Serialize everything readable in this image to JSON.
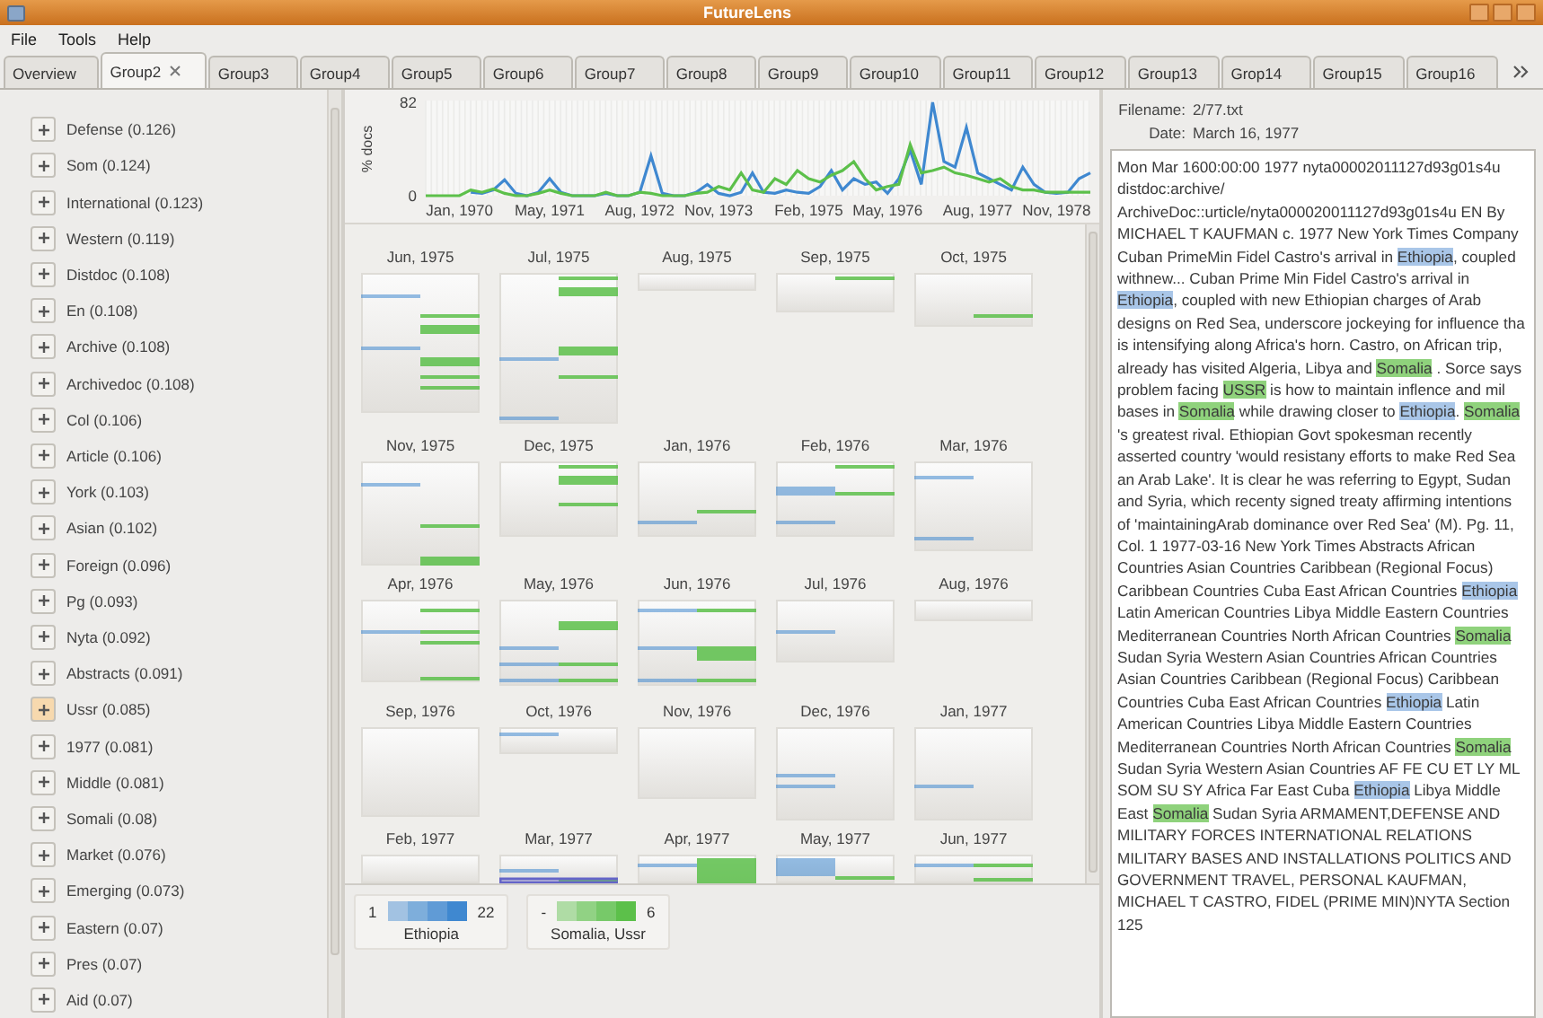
{
  "window": {
    "title": "FutureLens"
  },
  "menu": [
    "File",
    "Tools",
    "Help"
  ],
  "tabs": [
    {
      "label": "Overview",
      "selected": false
    },
    {
      "label": "Group2",
      "selected": true
    },
    {
      "label": "Group3",
      "selected": false
    },
    {
      "label": "Group4",
      "selected": false
    },
    {
      "label": "Group5",
      "selected": false
    },
    {
      "label": "Group6",
      "selected": false
    },
    {
      "label": "Group7",
      "selected": false
    },
    {
      "label": "Group8",
      "selected": false
    },
    {
      "label": "Group9",
      "selected": false
    },
    {
      "label": "Group10",
      "selected": false
    },
    {
      "label": "Group11",
      "selected": false
    },
    {
      "label": "Group12",
      "selected": false
    },
    {
      "label": "Group13",
      "selected": false
    },
    {
      "label": "Grop14",
      "selected": false
    },
    {
      "label": "Group15",
      "selected": false
    },
    {
      "label": "Group16",
      "selected": false
    }
  ],
  "sidebar": {
    "terms": [
      {
        "label": "Defense (0.126)",
        "selected": false
      },
      {
        "label": "Som (0.124)",
        "selected": false
      },
      {
        "label": "International (0.123)",
        "selected": false
      },
      {
        "label": "Western (0.119)",
        "selected": false
      },
      {
        "label": "Distdoc (0.108)",
        "selected": false
      },
      {
        "label": "En (0.108)",
        "selected": false
      },
      {
        "label": "Archive (0.108)",
        "selected": false
      },
      {
        "label": "Archivedoc (0.108)",
        "selected": false
      },
      {
        "label": "Col (0.106)",
        "selected": false
      },
      {
        "label": "Article (0.106)",
        "selected": false
      },
      {
        "label": "York (0.103)",
        "selected": false
      },
      {
        "label": "Asian (0.102)",
        "selected": false
      },
      {
        "label": "Foreign (0.096)",
        "selected": false
      },
      {
        "label": "Pg (0.093)",
        "selected": false
      },
      {
        "label": "Nyta (0.092)",
        "selected": false
      },
      {
        "label": "Abstracts (0.091)",
        "selected": false
      },
      {
        "label": "Ussr (0.085)",
        "selected": true
      },
      {
        "label": "1977 (0.081)",
        "selected": false
      },
      {
        "label": "Middle (0.081)",
        "selected": false
      },
      {
        "label": "Somali (0.08)",
        "selected": false
      },
      {
        "label": "Market (0.076)",
        "selected": false
      },
      {
        "label": "Emerging (0.073)",
        "selected": false
      },
      {
        "label": "Eastern (0.07)",
        "selected": false
      },
      {
        "label": "Pres (0.07)",
        "selected": false
      },
      {
        "label": "Aid (0.07)",
        "selected": false
      }
    ]
  },
  "timeline": {
    "chart_data": {
      "type": "line",
      "grid": true,
      "ylabel": "% docs",
      "ylim": [
        0,
        82
      ],
      "yticks": [
        0,
        82
      ],
      "categories": [
        null,
        null,
        null,
        "Jan, 1970",
        null,
        null,
        null,
        null,
        null,
        null,
        null,
        "May, 1971",
        null,
        null,
        null,
        null,
        null,
        null,
        null,
        "Aug, 1972",
        null,
        null,
        null,
        null,
        null,
        null,
        "Nov, 1973",
        null,
        null,
        null,
        null,
        null,
        null,
        null,
        "Feb, 1975",
        null,
        null,
        null,
        null,
        null,
        null,
        "May, 1976",
        null,
        null,
        null,
        null,
        null,
        null,
        null,
        "Aug, 1977",
        null,
        null,
        null,
        null,
        null,
        null,
        "Nov, 1978",
        null,
        null,
        null
      ],
      "series": [
        {
          "color": "#3f88d0",
          "values": [
            null,
            null,
            null,
            null,
            3,
            2,
            5,
            14,
            2,
            0,
            3,
            15,
            3,
            0,
            0,
            0,
            2,
            0,
            0,
            3,
            35,
            2,
            0,
            0,
            3,
            10,
            2,
            0,
            3,
            20,
            3,
            2,
            5,
            3,
            2,
            8,
            22,
            5,
            15,
            10,
            12,
            2,
            15,
            40,
            10,
            82,
            30,
            25,
            60,
            20,
            15,
            10,
            5,
            25,
            10,
            3,
            2,
            3,
            15,
            20
          ]
        },
        {
          "color": "#5cc04a",
          "values": [
            0,
            0,
            0,
            0,
            5,
            3,
            6,
            2,
            0,
            0,
            2,
            5,
            2,
            0,
            0,
            0,
            3,
            0,
            0,
            3,
            2,
            0,
            0,
            0,
            2,
            3,
            8,
            5,
            20,
            5,
            3,
            15,
            10,
            22,
            15,
            12,
            18,
            22,
            30,
            15,
            5,
            8,
            10,
            45,
            20,
            22,
            25,
            20,
            18,
            15,
            12,
            15,
            8,
            5,
            5,
            3,
            3,
            3,
            3,
            3
          ]
        }
      ]
    }
  },
  "calendar": {
    "months": [
      {
        "label": "Jun, 1975"
      },
      {
        "label": "Jul, 1975"
      },
      {
        "label": "Aug, 1975"
      },
      {
        "label": "Sep, 1975"
      },
      {
        "label": "Oct, 1975"
      },
      {
        "label": "Nov, 1975"
      },
      {
        "label": "Dec, 1975"
      },
      {
        "label": "Jan, 1976"
      },
      {
        "label": "Feb, 1976"
      },
      {
        "label": "Mar, 1976"
      },
      {
        "label": "Apr, 1976"
      },
      {
        "label": "May, 1976"
      },
      {
        "label": "Jun, 1976"
      },
      {
        "label": "Jul, 1976"
      },
      {
        "label": "Aug, 1976"
      },
      {
        "label": "Sep, 1976"
      },
      {
        "label": "Oct, 1976"
      },
      {
        "label": "Nov, 1976"
      },
      {
        "label": "Dec, 1976"
      },
      {
        "label": "Jan, 1977"
      },
      {
        "label": "Feb, 1977"
      },
      {
        "label": "Mar, 1977"
      },
      {
        "label": "Apr, 1977"
      },
      {
        "label": "May, 1977"
      },
      {
        "label": "Jun, 1977"
      }
    ],
    "legend": [
      {
        "min": "1",
        "max": "22",
        "label": "Ethiopia",
        "color": "#3f88d0"
      },
      {
        "min": "-",
        "max": "6",
        "label": "Somalia, Ussr",
        "color": "#5cc04a"
      }
    ]
  },
  "document": {
    "filename_label": "Filename:",
    "filename": "2/77.txt",
    "date_label": "Date:",
    "date": "March 16, 1977",
    "segments": [
      {
        "text": "Mon Mar 1600:00:00 1977 nyta00002011127d93g01s4u distdoc:archive/ ArchiveDoc::urticle/nyta000020011127d93g01s4u EN By MICHAEL T KAUFMAN c. 1977 New York Times Company Cuban PrimeMin Fidel Castro's arrival in "
      },
      {
        "text": "Ethiopia",
        "color": "#a9c6e8"
      },
      {
        "text": ", coupled withnew... Cuban Prime Min Fidel Castro's arrival in "
      },
      {
        "text": "Ethiopia",
        "color": "#a9c6e8"
      },
      {
        "text": ", coupled with new Ethiopian charges of Arab designs on Red Sea, underscore jockeying for influence tha is intensifying along Africa's horn. Castro, on African trip, already has visited Algeria, Libya and "
      },
      {
        "text": "Somalia",
        "color": "#8fd27c"
      },
      {
        "text": " . Sorce says problem facing "
      },
      {
        "text": "USSR",
        "color": "#8fd27c"
      },
      {
        "text": " is how to maintain inflence and mil bases in "
      },
      {
        "text": "Somalia",
        "color": "#8fd27c"
      },
      {
        "text": " while drawing closer to "
      },
      {
        "text": "Ethiopia",
        "color": "#a9c6e8"
      },
      {
        "text": ". "
      },
      {
        "text": "Somalia",
        "color": "#8fd27c"
      },
      {
        "text": " 's greatest rival. Ethiopian Govt spokesman recently asserted country 'would resistany efforts to make Red Sea an Arab Lake'. It is clear he was referring to Egypt, Sudan and Syria, which recenty signed treaty affirming intentions of 'maintainingArab dominance over Red Sea' (M). Pg. 11, Col. 1 1977-03-16 New York Times Abstracts African Countries Asian Countries Caribbean (Regional Focus) Caribbean Countries Cuba East African Countries "
      },
      {
        "text": "Ethiopia",
        "color": "#a9c6e8"
      },
      {
        "text": " Latin American Countries Libya Middle Eastern Countries Mediterranean Countries North African Countries "
      },
      {
        "text": "Somalia",
        "color": "#8fd27c"
      },
      {
        "text": " Sudan Syria Western Asian Countries African Countries Asian Countries Caribbean (Regional Focus) Caribbean Countries Cuba East African Countries "
      },
      {
        "text": "Ethiopia",
        "color": "#a9c6e8"
      },
      {
        "text": " Latin American Countries Libya Middle Eastern Countries Mediterranean Countries North African Countries "
      },
      {
        "text": "Somalia",
        "color": "#8fd27c"
      },
      {
        "text": " Sudan Syria Western Asian Countries AF FE CU ET LY ML SOM SU SY Africa Far East Cuba "
      },
      {
        "text": "Ethiopia",
        "color": "#a9c6e8"
      },
      {
        "text": " Libya Middle East "
      },
      {
        "text": "Somalia",
        "color": "#8fd27c"
      },
      {
        "text": " Sudan Syria ARMAMENT,DEFENSE AND MILITARY FORCES INTERNATIONAL RELATIONS MILITARY BASES AND INSTALLATIONS POLITICS AND GOVERNMENT TRAVEL, PERSONAL KAUFMAN, MICHAEL T CASTRO, FIDEL (PRIME MIN)NYTA Section 125"
      }
    ]
  }
}
